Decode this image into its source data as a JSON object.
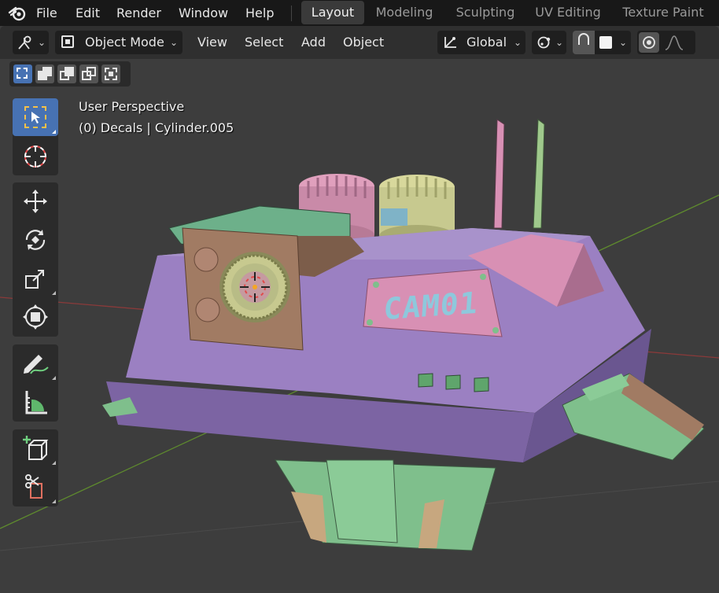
{
  "topbar": {
    "menus": [
      "File",
      "Edit",
      "Render",
      "Window",
      "Help"
    ],
    "workspaces": [
      {
        "label": "Layout",
        "active": true
      },
      {
        "label": "Modeling",
        "active": false
      },
      {
        "label": "Sculpting",
        "active": false
      },
      {
        "label": "UV Editing",
        "active": false
      },
      {
        "label": "Texture Paint",
        "active": false
      }
    ]
  },
  "header": {
    "mode": "Object Mode",
    "menus": [
      "View",
      "Select",
      "Add",
      "Object"
    ],
    "orientation": "Global"
  },
  "viewport": {
    "view_name": "User Perspective",
    "object_info": "(0) Decals | Cylinder.005",
    "decal_text": "CAM01"
  },
  "toolbar": {
    "tools": [
      "select-box",
      "cursor",
      "move",
      "rotate",
      "scale",
      "transform",
      "annotate",
      "measure",
      "add-cube",
      "shear"
    ],
    "active_tool": "select-box"
  },
  "colors": {
    "accent": "#4772b3",
    "body_purple": "#9b80c2",
    "mint": "#7fbf8c",
    "pink": "#d890b4",
    "olive": "#c7c98f",
    "brown": "#a17b63"
  }
}
